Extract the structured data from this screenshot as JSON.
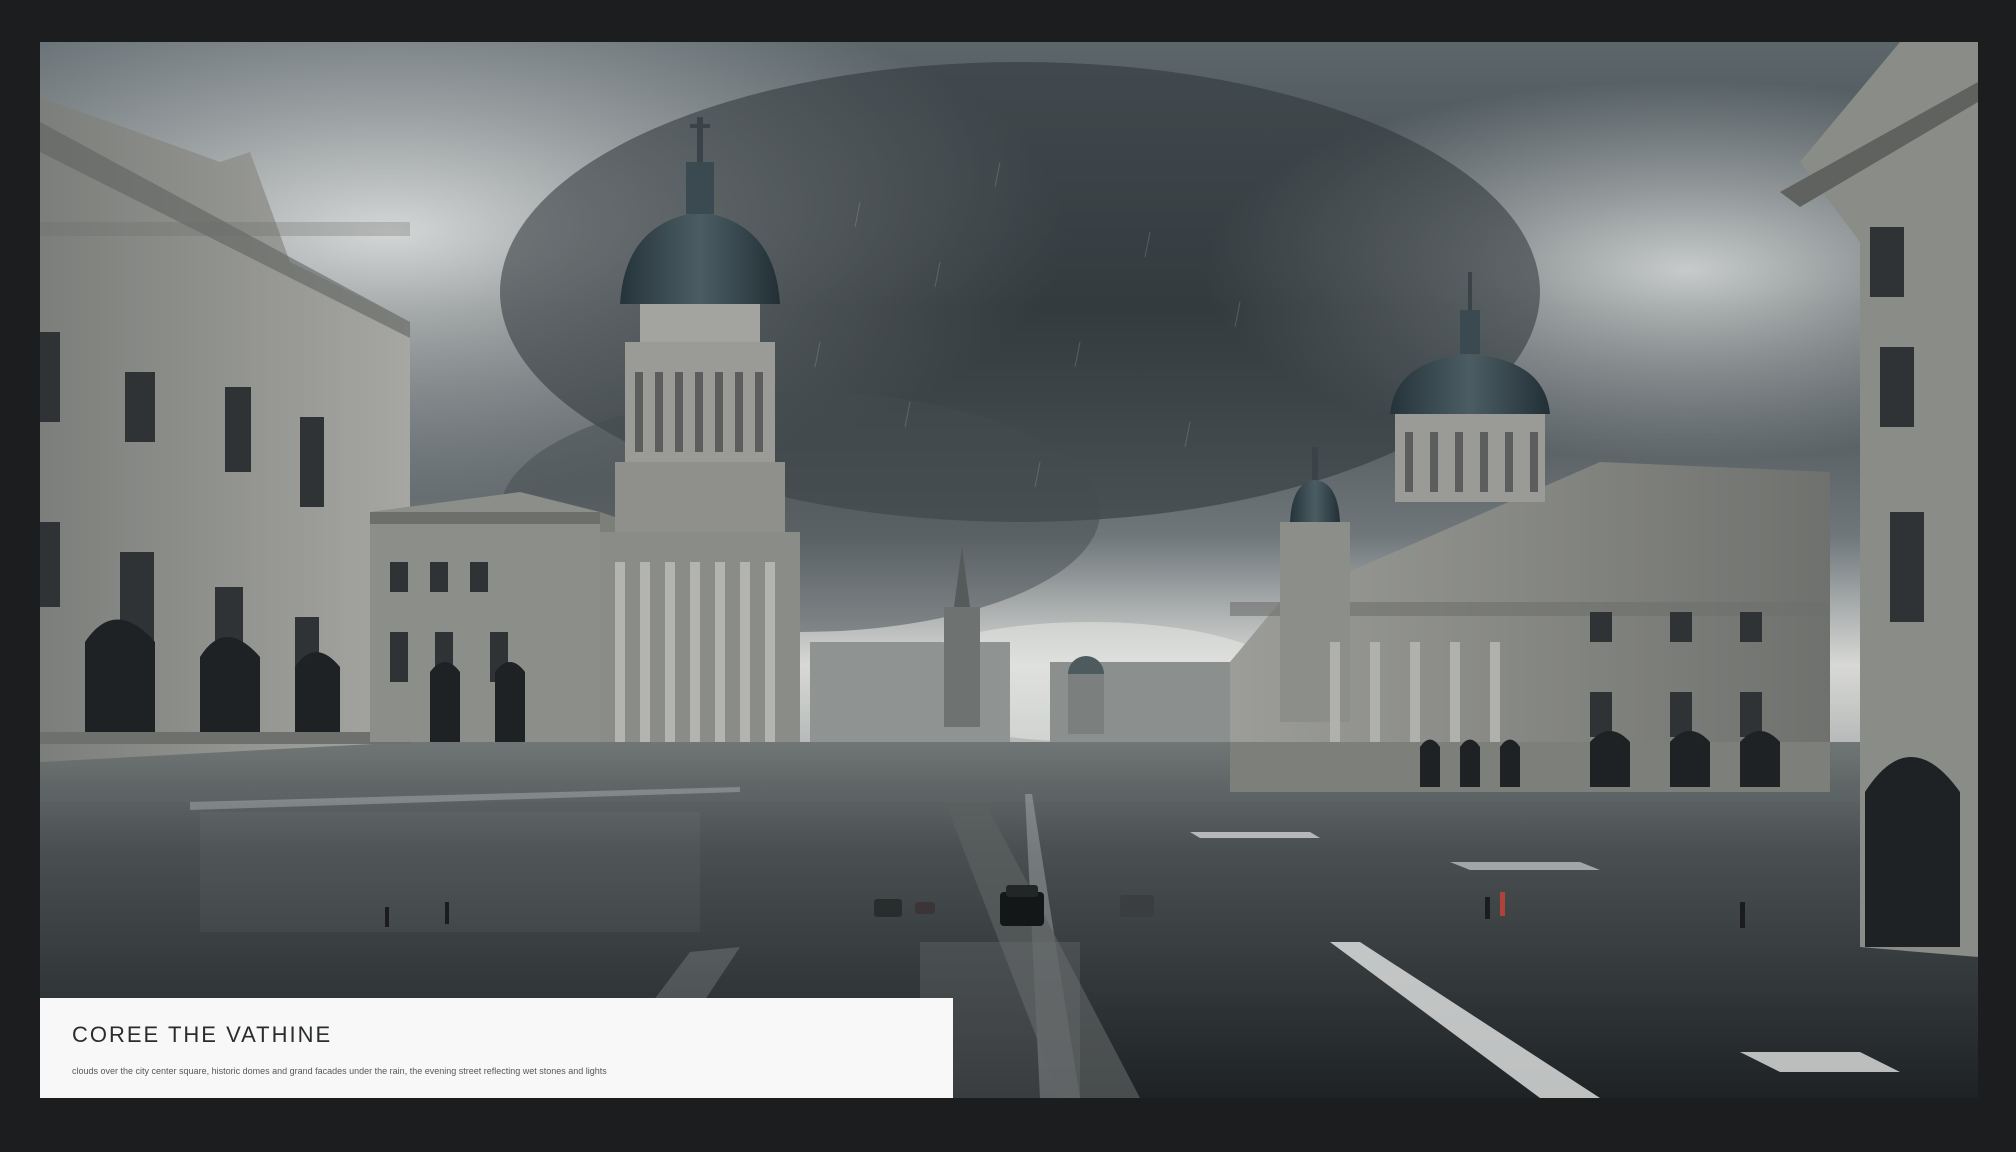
{
  "image": {
    "description_icon": "photo-icon"
  },
  "caption": {
    "title": "COREE THE VATHINE",
    "body": "clouds over the city center square, historic domes and grand facades under the rain, the evening street reflecting wet stones and lights"
  },
  "colors": {
    "frame": "#1c1d1f",
    "sky_dark": "#3b4347",
    "sky_light": "#c9cdcf",
    "stone": "#8e8f8a",
    "dome": "#34444a",
    "road": "#2f3336",
    "panel": "#f7f8f7"
  }
}
